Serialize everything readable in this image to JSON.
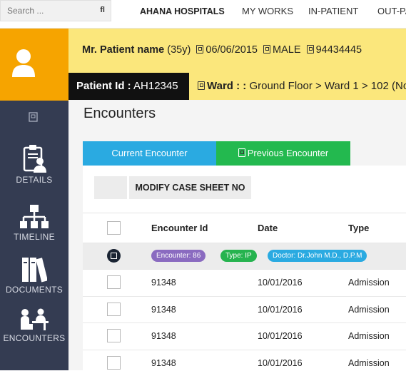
{
  "topbar": {
    "search_placeholder": "Search ...",
    "search_icon_glyph": "fl",
    "brand": "AHANA HOSPITALS",
    "nav": [
      "MY WORKS",
      "IN-PATIENT",
      "OUT-PA"
    ]
  },
  "sidebar": {
    "items": [
      {
        "label": "DETAILS",
        "icon": "clipboard-user-icon"
      },
      {
        "label": "TIMELINE",
        "icon": "sitemap-icon"
      },
      {
        "label": "DOCUMENTS",
        "icon": "books-icon"
      },
      {
        "label": "ENCOUNTERS",
        "icon": "consultation-icon"
      }
    ]
  },
  "patient": {
    "name": "Mr. Patient name",
    "age": "(35y)",
    "dob": "06/06/2015",
    "gender": "MALE",
    "phone": "94434445",
    "id_label": "Patient Id :",
    "id_value": "AH12345",
    "ward_label": "Ward : :",
    "ward_value": "Ground Floor > Ward 1 > 102 (No"
  },
  "main": {
    "title": "Encounters",
    "tabs": {
      "current": "Current Encounter",
      "previous": "Previous Encounter"
    },
    "modify_button": "MODIFY CASE SHEET NO",
    "columns": {
      "id": "Encounter Id",
      "date": "Date",
      "type": "Type"
    },
    "group": {
      "encounter": "Encounter: 86",
      "type": "Type: IP",
      "doctor": "Doctor: Dr.John M.D., D.P.M"
    },
    "rows": [
      {
        "id": "91348",
        "date": "10/01/2016",
        "type": "Admission"
      },
      {
        "id": "91348",
        "date": "10/01/2016",
        "type": "Admission"
      },
      {
        "id": "91348",
        "date": "10/01/2016",
        "type": "Admission"
      },
      {
        "id": "91348",
        "date": "10/01/2016",
        "type": "Admission"
      }
    ]
  },
  "colors": {
    "sidebar": "#343c52",
    "avatar_bg": "#f6a400",
    "patient_bar": "#fbe77c",
    "tab_current": "#2aaae1",
    "tab_previous": "#23b94f",
    "badge_encounter": "#8a6bc0",
    "badge_type": "#26b34f",
    "badge_doctor": "#2aaae1"
  }
}
